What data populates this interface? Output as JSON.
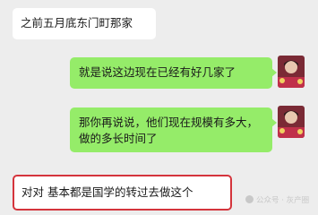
{
  "messages": [
    {
      "side": "left",
      "text": "之前五月底东门町那家"
    },
    {
      "side": "right",
      "text": "就是说这边现在已经有好几家了"
    },
    {
      "side": "right",
      "text": "那你再说说，他们现在规模有多大，做的多长时间了"
    },
    {
      "side": "left",
      "text": "对对 基本都是国学的转过去做这个",
      "highlighted": true
    }
  ],
  "watermark": {
    "text": "公众号 · 灰产圈"
  },
  "colors": {
    "background": "#ededed",
    "incoming_bubble": "#ffffff",
    "outgoing_bubble": "#95ec69",
    "highlight_border": "#d4343c"
  }
}
